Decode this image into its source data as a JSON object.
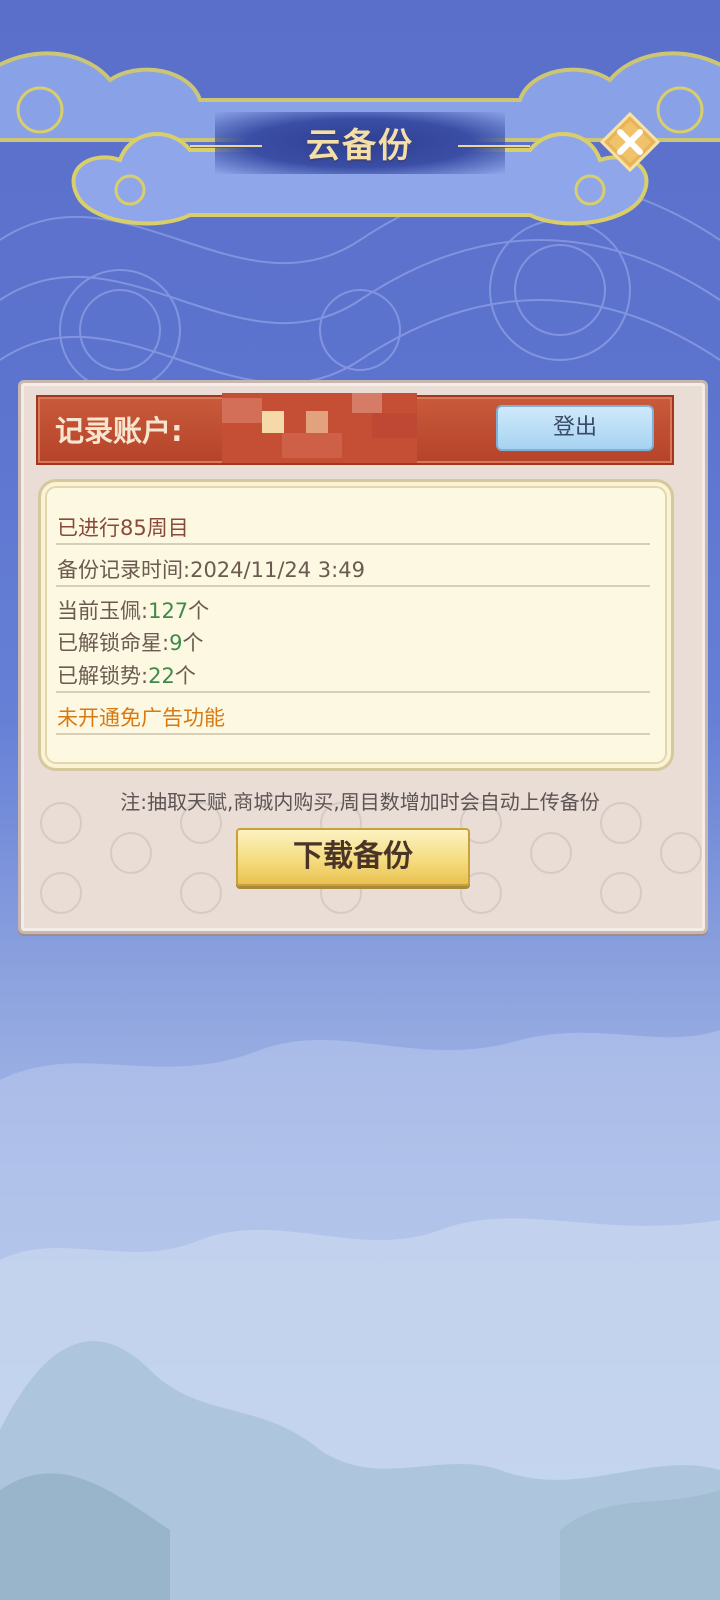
{
  "header": {
    "title": "云备份",
    "close_icon": "close-icon"
  },
  "account": {
    "label": "记录账户:",
    "logout_label": "登出"
  },
  "info": {
    "cycles": "已进行85周目",
    "backup_time_label": "备份记录时间:",
    "backup_time_value": "2024/11/24 3:49",
    "jade_label": "当前玉佩:",
    "jade_value": "127",
    "jade_unit": "个",
    "stars_label": "已解锁命星:",
    "stars_value": "9",
    "stars_unit": "个",
    "stances_label": "已解锁势:",
    "stances_value": "22",
    "stances_unit": "个",
    "ad_status": "未开通免广告功能"
  },
  "note": "注:抽取天赋,商城内购买,周目数增加时会自动上传备份",
  "download_label": "下载备份",
  "colors": {
    "accent_red": "#b5432a",
    "gold": "#f4da7a",
    "green": "#3e8a4a",
    "orange": "#d87a14"
  }
}
